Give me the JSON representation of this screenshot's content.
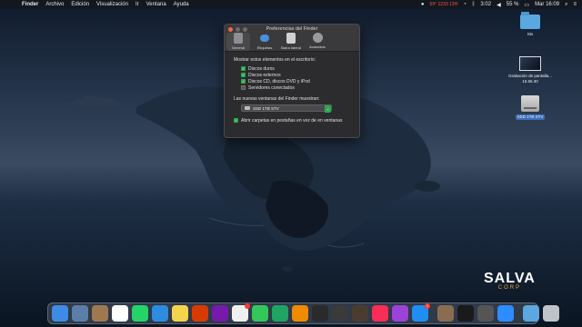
{
  "menubar": {
    "app_name": "Finder",
    "items": [
      "Archivo",
      "Edición",
      "Visualización",
      "Ir",
      "Ventana",
      "Ayuda"
    ],
    "status_text": "59° 1233 13H",
    "battery": "55 %",
    "time_short": "3:02",
    "datetime": "Mar 16:09"
  },
  "window": {
    "title": "Preferencias del Finder",
    "tabs": [
      {
        "label": "General",
        "color": "#8e8e93"
      },
      {
        "label": "Etiquetas",
        "color": "#4a90d9"
      },
      {
        "label": "Barra lateral",
        "color": "#b0b0b0"
      },
      {
        "label": "Avanzado",
        "color": "#9a9a9a"
      }
    ],
    "section_label": "Mostrar estos elementos en el escritorio:",
    "checkboxes": [
      {
        "label": "Discos duros",
        "checked": true
      },
      {
        "label": "Discos externos",
        "checked": true
      },
      {
        "label": "Discos CD, discos DVD y iPod",
        "checked": true
      },
      {
        "label": "Servidores conectados",
        "checked": false
      }
    ],
    "new_windows_label": "Las nuevas ventanas del Finder muestran:",
    "new_windows_value": "SSD 1TB STV",
    "tabs_option": {
      "label": "Abrir carpetas en pestañas en vez de en ventanas",
      "checked": true
    }
  },
  "desktop": {
    "icons": [
      {
        "label": "Stv",
        "kind": "folder"
      },
      {
        "label": "Grabación de pantalla... 15.55.30",
        "kind": "video"
      },
      {
        "label": "SSD 1TB STV",
        "kind": "disk"
      }
    ]
  },
  "brand": {
    "name": "SALVA",
    "sub": "CORP"
  },
  "dock": {
    "apps": [
      {
        "name": "finder-icon",
        "color": "#3c8ce7"
      },
      {
        "name": "preview-icon",
        "color": "#5a7ea8"
      },
      {
        "name": "notes-brown-icon",
        "color": "#a07850"
      },
      {
        "name": "calendar-icon",
        "color": "#ffffff"
      },
      {
        "name": "whatsapp-icon",
        "color": "#25d366"
      },
      {
        "name": "safari-icon",
        "color": "#2d8be0"
      },
      {
        "name": "notes-icon",
        "color": "#f5d34a"
      },
      {
        "name": "office-icon",
        "color": "#d83b01"
      },
      {
        "name": "onenote-icon",
        "color": "#7719aa"
      },
      {
        "name": "photos-icon",
        "color": "#f0f0f0"
      },
      {
        "name": "messages-icon",
        "color": "#34c759"
      },
      {
        "name": "sheets-icon",
        "color": "#1fa463"
      },
      {
        "name": "vlc-icon",
        "color": "#f08a00"
      },
      {
        "name": "box-icon",
        "color": "#2a2a2a"
      },
      {
        "name": "network-icon",
        "color": "#3a3a3a"
      },
      {
        "name": "books-icon",
        "color": "#4a3d30"
      },
      {
        "name": "music-icon",
        "color": "#fa2d55"
      },
      {
        "name": "podcasts-icon",
        "color": "#9b42d8"
      },
      {
        "name": "appstore-icon",
        "color": "#1e8ef2"
      },
      {
        "name": "stack-icon",
        "color": "#8a6d50"
      },
      {
        "name": "terminal-icon",
        "color": "#1a1a1a"
      },
      {
        "name": "finder-list-icon",
        "color": "#555"
      },
      {
        "name": "zoom-icon",
        "color": "#2d8cff"
      },
      {
        "name": "downloads-folder-icon",
        "color": "#5ba7df"
      },
      {
        "name": "trash-icon",
        "color": "#bfc4c8"
      }
    ],
    "badges": {
      "photos-icon": "",
      "appstore-icon": "1"
    }
  }
}
